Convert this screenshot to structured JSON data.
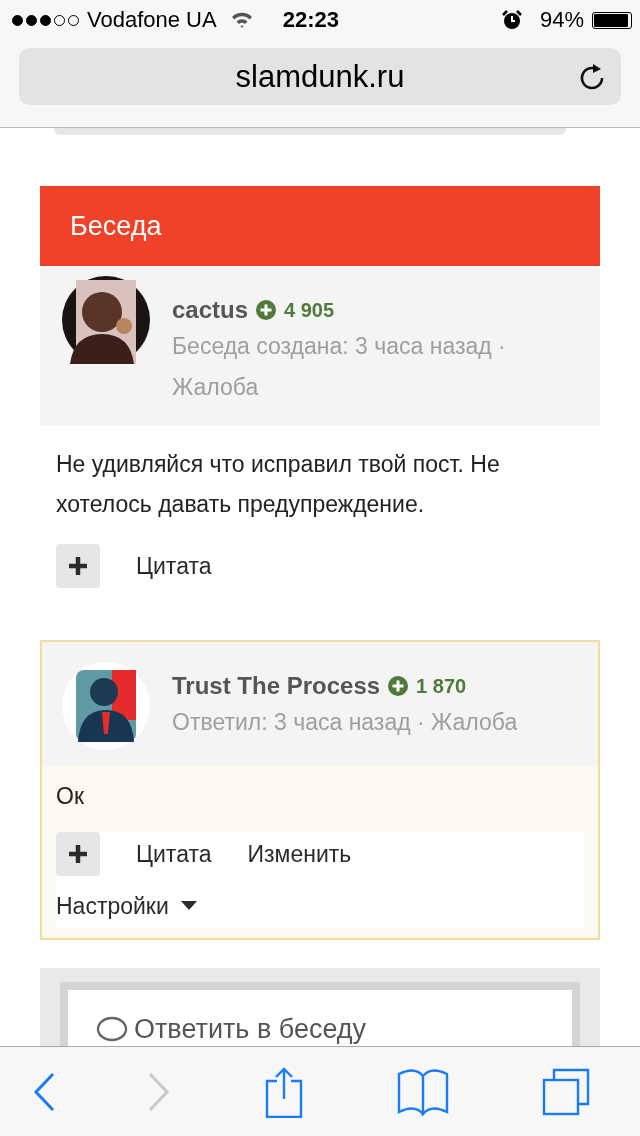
{
  "status_bar": {
    "carrier": "Vodafone UA",
    "time": "22:23",
    "battery": "94%"
  },
  "address_bar": {
    "url": "slamdunk.ru"
  },
  "section_title": "Беседа",
  "posts": [
    {
      "author": "cactus",
      "reputation": "4 905",
      "meta": "Беседа создана: 3 часа назад ·",
      "report": "Жалоба",
      "highlighted": false,
      "body": "Не удивляйся что исправил твой пост. Не хотелось давать предупреждение.",
      "actions": [
        {
          "kind": "link",
          "label": "Цитата"
        }
      ]
    },
    {
      "author": "Trust The Process",
      "reputation": "1 870",
      "meta": "Ответил: 3 часа назад ·",
      "report": "Жалоба",
      "highlighted": true,
      "body": "Ок",
      "actions": [
        {
          "kind": "link",
          "label": "Цитата"
        },
        {
          "kind": "link",
          "label": "Изменить"
        },
        {
          "kind": "dropdown",
          "label": "Настройки"
        }
      ]
    }
  ],
  "reply_box": {
    "label": "Ответить в беседу"
  },
  "toolbar": [
    {
      "kind": "back",
      "disabled": false
    },
    {
      "kind": "forward",
      "disabled": true
    },
    {
      "kind": "share",
      "disabled": false
    },
    {
      "kind": "bookmarks",
      "disabled": false
    },
    {
      "kind": "tabs",
      "disabled": false
    }
  ]
}
